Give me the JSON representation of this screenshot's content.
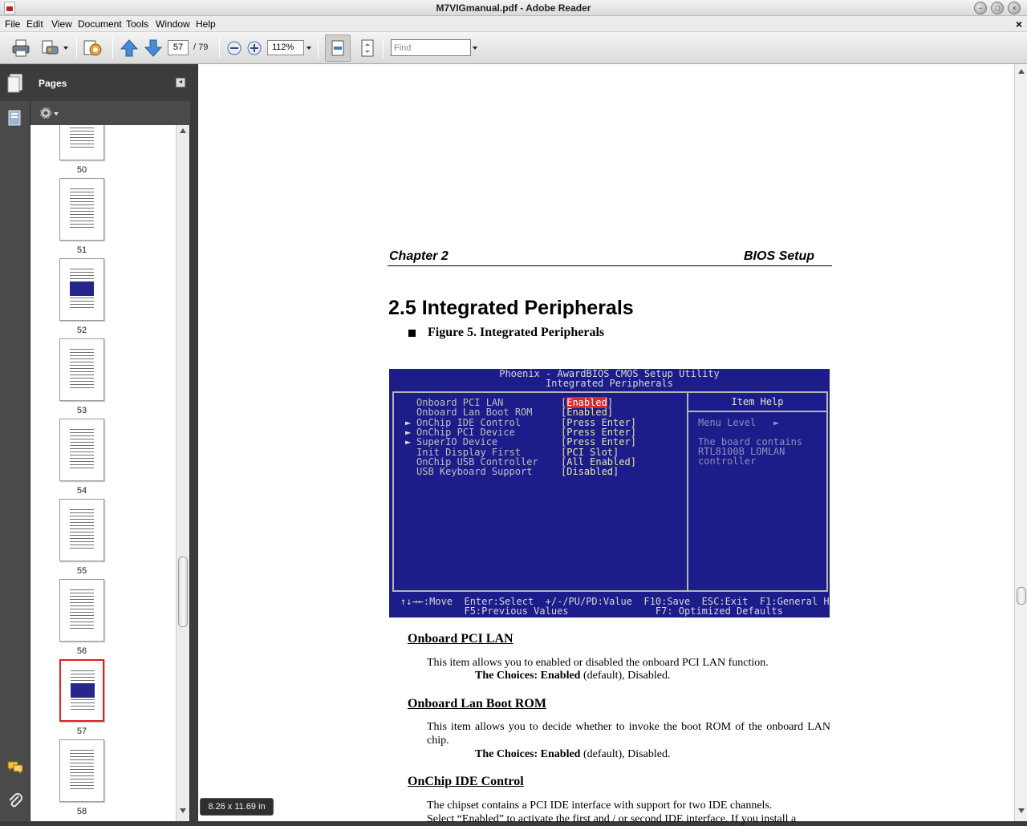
{
  "window": {
    "title": "M7VIGmanual.pdf - Adobe Reader",
    "controls": [
      "minimize",
      "maximize",
      "close"
    ]
  },
  "menu": {
    "items": [
      "File",
      "Edit",
      "View",
      "Document",
      "Tools",
      "Window",
      "Help"
    ],
    "close_glyph": "×"
  },
  "toolbar": {
    "current_page": "57",
    "total_pages": "/ 79",
    "zoom": "112%",
    "find_placeholder": "Find",
    "icons": [
      "print-icon",
      "printer-options-icon",
      "collaborate-icon",
      "previous-page-icon",
      "next-page-icon",
      "zoom-out-icon",
      "zoom-in-icon",
      "fit-width-icon",
      "fit-page-icon"
    ]
  },
  "pages_panel": {
    "title": "Pages",
    "options_icon": "gear-icon",
    "thumbnails": [
      {
        "label": "50",
        "kind": "text"
      },
      {
        "label": "51",
        "kind": "text"
      },
      {
        "label": "52",
        "kind": "bios"
      },
      {
        "label": "53",
        "kind": "text"
      },
      {
        "label": "54",
        "kind": "text"
      },
      {
        "label": "55",
        "kind": "text"
      },
      {
        "label": "56",
        "kind": "text"
      },
      {
        "label": "57",
        "kind": "bios",
        "selected": true
      },
      {
        "label": "58",
        "kind": "text"
      }
    ]
  },
  "document": {
    "chapter_left": "Chapter 2",
    "chapter_right": "BIOS Setup",
    "section_title": "2.5 Integrated Peripherals",
    "figure_caption": "Figure 5. Integrated Peripherals",
    "bios": {
      "header1": "Phoenix - AwardBIOS CMOS Setup Utility",
      "header2": "Integrated Peripherals",
      "help_title": "Item Help",
      "menu_level": "Menu Level",
      "menu_level_arrow": "►",
      "help_lines": [
        "The board contains",
        "RTL8100B LOMLAN",
        "controller"
      ],
      "rows": [
        {
          "name": "Onboard PCI LAN",
          "value_open": "[",
          "value": "Enabled",
          "value_close": "]",
          "submenu": false
        },
        {
          "name": "Onboard Lan Boot ROM",
          "value_open": "[",
          "value": "Enabled",
          "value_close": "]",
          "submenu": false
        },
        {
          "name": "OnChip IDE Control",
          "value_open": "[",
          "value": "Press Enter",
          "value_close": "]",
          "submenu": true
        },
        {
          "name": "OnChip PCI Device",
          "value_open": "[",
          "value": "Press Enter",
          "value_close": "]",
          "submenu": true
        },
        {
          "name": "SuperIO Device",
          "value_open": "[",
          "value": "Press Enter",
          "value_close": "]",
          "submenu": true
        },
        {
          "name": "Init Display First",
          "value_open": "[",
          "value": "PCI Slot",
          "value_close": "]",
          "submenu": false
        },
        {
          "name": "OnChip USB Controller",
          "value_open": "[",
          "value": "All Enabled",
          "value_close": "]",
          "submenu": false
        },
        {
          "name": "USB Keyboard Support",
          "value_open": "[",
          "value": "Disabled",
          "value_close": "]",
          "submenu": false
        }
      ],
      "submenu_glyph": "►",
      "footer1": "↑↓→←:Move  Enter:Select  +/-/PU/PD:Value  F10:Save  ESC:Exit  F1:General Help",
      "footer2": "           F5:Previous Values               F7: Optimized Defaults"
    },
    "items": [
      {
        "title": "Onboard PCI LAN",
        "desc": "This item allows you to enabled or disabled the onboard PCI LAN function.",
        "choices_label": "The Choices:",
        "choices_bold": "Enabled",
        "choices_rest": "(default), Disabled."
      },
      {
        "title": "Onboard Lan Boot ROM",
        "desc": "This item allows you to decide whether to invoke the boot ROM of the onboard LAN chip.",
        "choices_label": "The Choices:",
        "choices_bold": "Enabled",
        "choices_rest": "(default), Disabled."
      },
      {
        "title": "OnChip IDE Control",
        "desc": "The chipset contains a PCI IDE interface with support for two IDE channels.",
        "desc2": "Select “Enabled” to activate the first and / or second IDE interface. If you install a"
      }
    ]
  },
  "status": {
    "page_size": "8.26 x 11.69 in"
  }
}
